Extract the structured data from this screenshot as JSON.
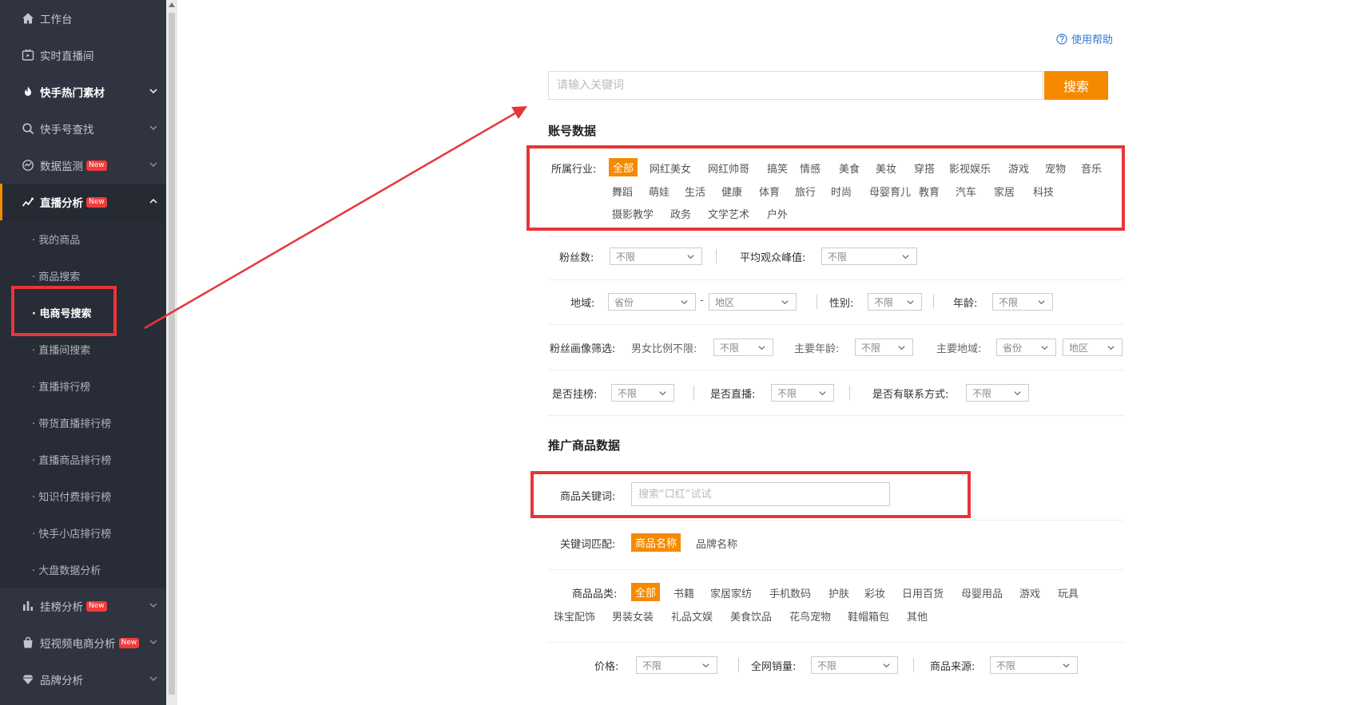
{
  "sidebar": {
    "items": [
      {
        "label": "工作台",
        "icon": "home-icon"
      },
      {
        "label": "实时直播间",
        "icon": "live-tv-icon"
      },
      {
        "label": "快手热门素材",
        "icon": "flame-icon"
      },
      {
        "label": "快手号查找",
        "icon": "search-icon"
      },
      {
        "label": "数据监测",
        "icon": "monitor-icon",
        "badge": "New"
      },
      {
        "label": "直播分析",
        "icon": "line-chart-icon",
        "badge": "New"
      },
      {
        "label": "挂榜分析",
        "icon": "bar-chart-icon",
        "badge": "New"
      },
      {
        "label": "短视频电商分析",
        "icon": "shopping-bag-icon",
        "badge": "New"
      },
      {
        "label": "品牌分析",
        "icon": "diamond-icon"
      }
    ],
    "subitems": [
      "· 我的商品",
      "· 商品搜索",
      "· 电商号搜索",
      "· 直播间搜索",
      "· 直播排行榜",
      "· 带货直播排行榜",
      "· 直播商品排行榜",
      "· 知识付费排行榜",
      "· 快手小店排行榜",
      "· 大盘数据分析"
    ]
  },
  "help": {
    "label": "使用帮助",
    "icon": "question-circle-icon"
  },
  "search": {
    "placeholder": "请输入关键词",
    "button": "搜索"
  },
  "account": {
    "title": "账号数据",
    "industry_label": "所属行业:",
    "industries": [
      "全部",
      "网红美女",
      "网红帅哥",
      "搞笑",
      "情感",
      "美食",
      "美妆",
      "穿搭",
      "影视娱乐",
      "游戏",
      "宠物",
      "音乐",
      "舞蹈",
      "萌娃",
      "生活",
      "健康",
      "体育",
      "旅行",
      "时尚",
      "母婴育儿",
      "教育",
      "汽车",
      "家居",
      "科技",
      "摄影教学",
      "政务",
      "文学艺术",
      "户外"
    ],
    "fans_label": "粉丝数:",
    "avg_peak_label": "平均观众峰值:",
    "region_label": "地域:",
    "province": "省份",
    "district": "地区",
    "dash": "-",
    "gender_label": "性别:",
    "age_label": "年龄:",
    "portrait_label": "粉丝画像筛选:",
    "ratio_label": "男女比例不限:",
    "main_age_label": "主要年龄:",
    "main_region_label": "主要地域:",
    "onlist_label": "是否挂榜:",
    "live_label": "是否直播:",
    "contact_label": "是否有联系方式:",
    "unlimited": "不限"
  },
  "product": {
    "title": "推广商品数据",
    "keyword_label": "商品关键词:",
    "keyword_placeholder": "搜索“口红”试试",
    "match_label": "关键词匹配:",
    "match_options": [
      "商品名称",
      "品牌名称"
    ],
    "category_label": "商品品类:",
    "categories": [
      "全部",
      "书籍",
      "家居家纺",
      "手机数码",
      "护肤",
      "彩妆",
      "日用百货",
      "母婴用品",
      "游戏",
      "玩具",
      "珠宝配饰",
      "男装女装",
      "礼品文娱",
      "美食饮品",
      "花鸟宠物",
      "鞋帽箱包",
      "其他"
    ],
    "price_label": "价格:",
    "sales_label": "全网销量:",
    "source_label": "商品来源:",
    "unlimited": "不限"
  },
  "colors": {
    "accent": "#f58a00",
    "annotation": "#e8353a",
    "sidebar_bg": "#2f3440",
    "link": "#2e7cd6"
  }
}
